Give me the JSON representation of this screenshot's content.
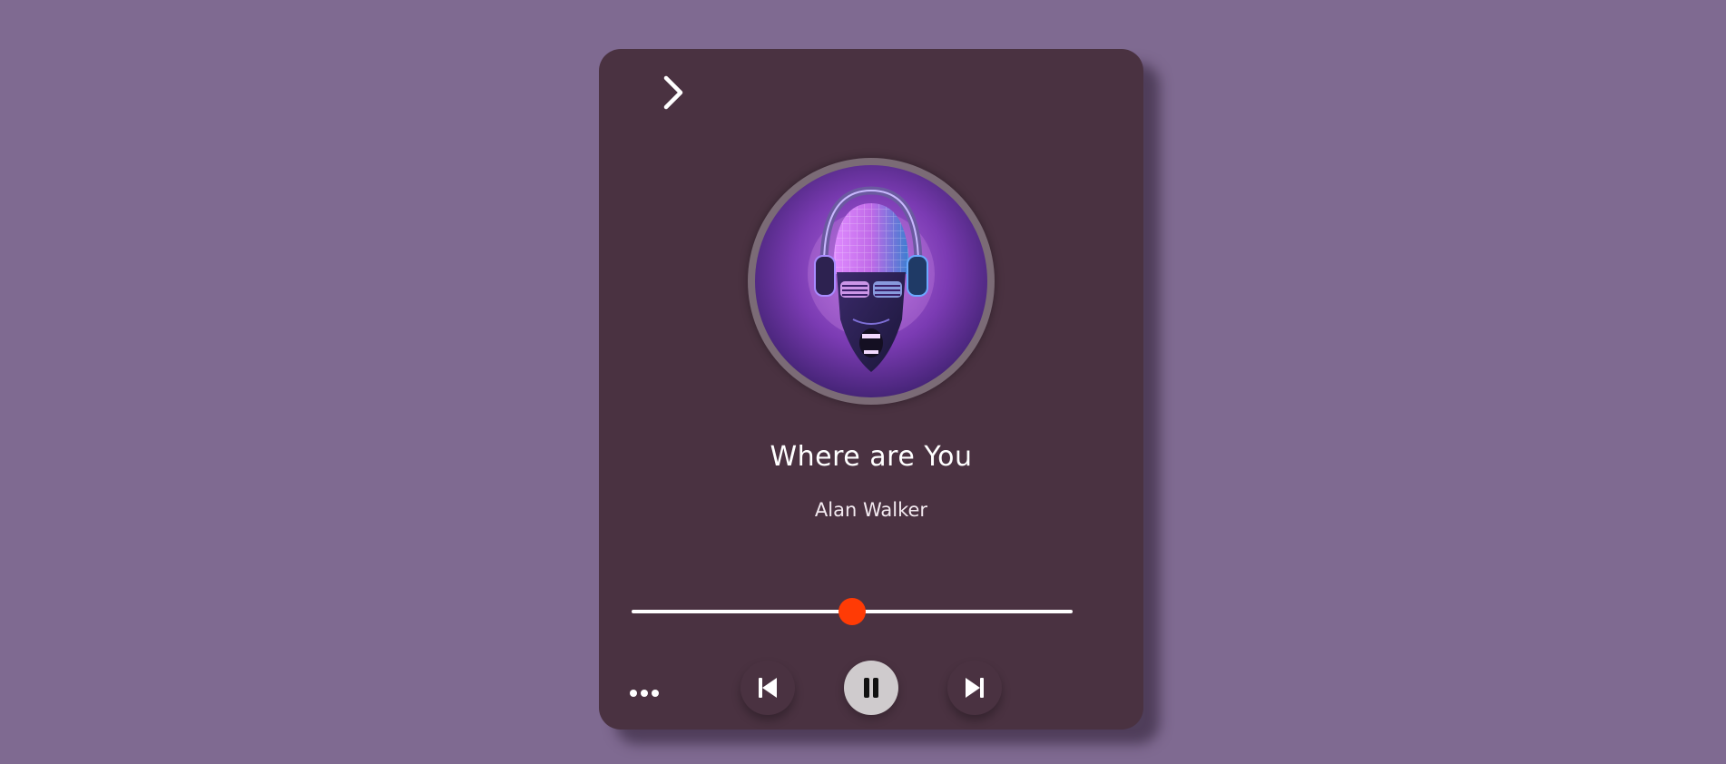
{
  "player": {
    "track_title": "Where are You",
    "artist": "Alan Walker",
    "progress_fraction": 0.5,
    "playing": true,
    "accent_color": "#ff3b05",
    "background_color": "#7f6a91",
    "card_color": "#4a3241"
  },
  "icons": {
    "back": "chevron-right-icon",
    "more": "more-dots-icon",
    "previous": "skip-previous-icon",
    "play_pause": "pause-icon",
    "next": "skip-next-icon",
    "cover": "album-art-skull-headphones"
  }
}
